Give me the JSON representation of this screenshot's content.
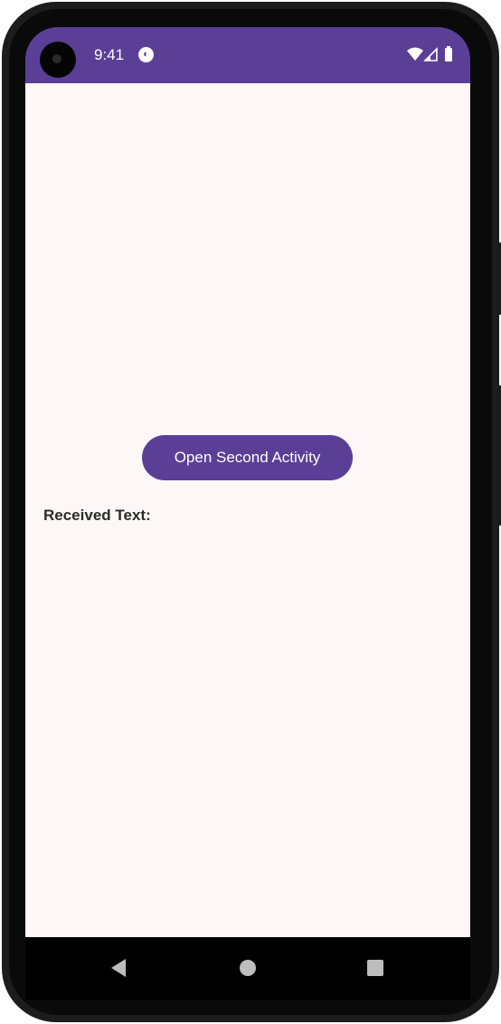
{
  "status_bar": {
    "time": "9:41",
    "color": "#5b3f97",
    "icons": [
      "camera-icon",
      "notification-icon",
      "wifi-icon",
      "signal-icon",
      "battery-icon"
    ]
  },
  "main": {
    "button_label": "Open Second Activity",
    "received_label": "Received Text:",
    "background": "#fdf7f7",
    "accent": "#5b3f97"
  },
  "nav_bar": {
    "buttons": [
      "back-icon",
      "home-icon",
      "recents-icon"
    ]
  }
}
